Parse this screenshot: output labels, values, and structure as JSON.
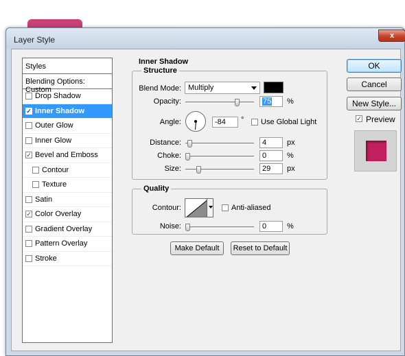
{
  "window": {
    "title": "Layer Style",
    "close_label": "x"
  },
  "styles": {
    "header": "Styles",
    "blending": "Blending Options: Custom",
    "items": [
      {
        "label": "Drop Shadow",
        "checked": false,
        "sub": false,
        "selected": false
      },
      {
        "label": "Inner Shadow",
        "checked": true,
        "sub": false,
        "selected": true
      },
      {
        "label": "Outer Glow",
        "checked": false,
        "sub": false,
        "selected": false
      },
      {
        "label": "Inner Glow",
        "checked": false,
        "sub": false,
        "selected": false
      },
      {
        "label": "Bevel and Emboss",
        "checked": true,
        "sub": false,
        "selected": false
      },
      {
        "label": "Contour",
        "checked": false,
        "sub": true,
        "selected": false
      },
      {
        "label": "Texture",
        "checked": false,
        "sub": true,
        "selected": false
      },
      {
        "label": "Satin",
        "checked": false,
        "sub": false,
        "selected": false
      },
      {
        "label": "Color Overlay",
        "checked": true,
        "sub": false,
        "selected": false
      },
      {
        "label": "Gradient Overlay",
        "checked": false,
        "sub": false,
        "selected": false
      },
      {
        "label": "Pattern Overlay",
        "checked": false,
        "sub": false,
        "selected": false
      },
      {
        "label": "Stroke",
        "checked": false,
        "sub": false,
        "selected": false
      }
    ]
  },
  "inner_shadow": {
    "title": "Inner Shadow",
    "structure": {
      "title": "Structure",
      "blend_mode_label": "Blend Mode:",
      "blend_mode_value": "Multiply",
      "color": "#000000",
      "opacity_label": "Opacity:",
      "opacity_value": "75",
      "opacity_unit": "%",
      "angle_label": "Angle:",
      "angle_value": "-84",
      "angle_unit": "°",
      "use_global_light_label": "Use Global Light",
      "use_global_light": false,
      "distance_label": "Distance:",
      "distance_value": "4",
      "distance_unit": "px",
      "choke_label": "Choke:",
      "choke_value": "0",
      "choke_unit": "%",
      "size_label": "Size:",
      "size_value": "29",
      "size_unit": "px"
    },
    "quality": {
      "title": "Quality",
      "contour_label": "Contour:",
      "anti_aliased_label": "Anti-aliased",
      "anti_aliased": false,
      "noise_label": "Noise:",
      "noise_value": "0",
      "noise_unit": "%"
    },
    "make_default": "Make Default",
    "reset_default": "Reset to Default"
  },
  "buttons": {
    "ok": "OK",
    "cancel": "Cancel",
    "new_style": "New Style...",
    "preview_label": "Preview",
    "preview": true
  },
  "colors": {
    "accent": "#3399ff",
    "preview_fill": "#c21f5e"
  }
}
